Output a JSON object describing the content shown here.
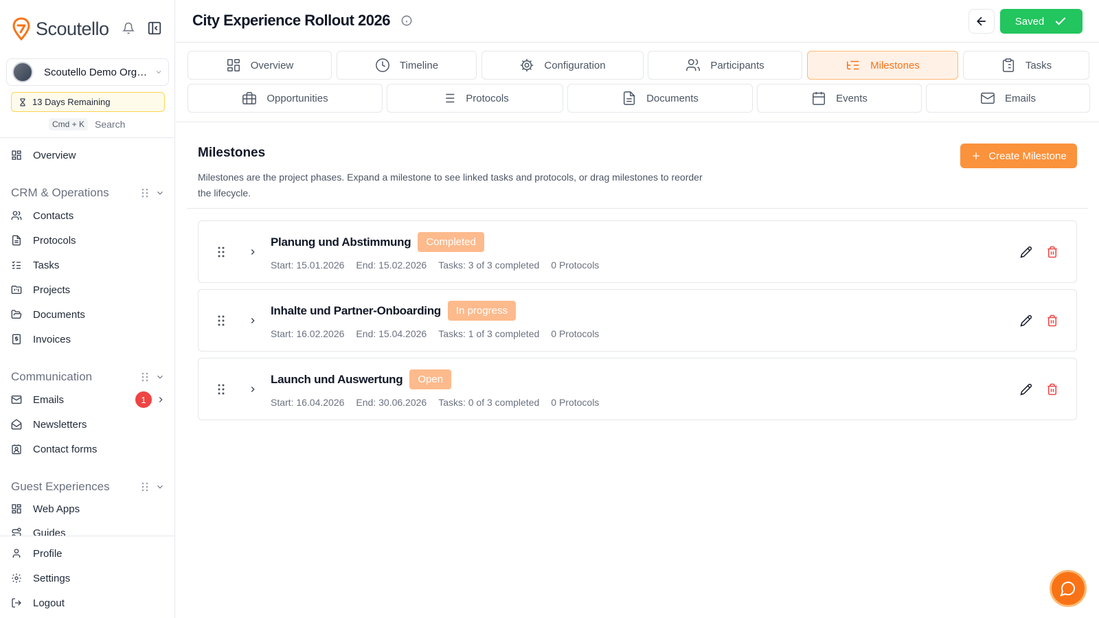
{
  "sidebar": {
    "brand": "Scoutello",
    "org_name": "Scoutello Demo Organization",
    "trial": "13 Days Remaining",
    "search_shortcut": "Cmd + K",
    "search_label": "Search",
    "overview": "Overview",
    "groups": {
      "crm": "CRM & Operations",
      "communication": "Communication",
      "guest": "Guest Experiences"
    },
    "crm_items": [
      "Contacts",
      "Protocols",
      "Tasks",
      "Projects",
      "Documents",
      "Invoices"
    ],
    "comm_items": [
      "Emails",
      "Newsletters",
      "Contact forms"
    ],
    "guest_items": [
      "Web Apps",
      "Guides"
    ],
    "email_badge": "1",
    "footer_items": [
      "Profile",
      "Settings",
      "Logout"
    ]
  },
  "header": {
    "title": "City Experience Rollout 2026",
    "saved_label": "Saved"
  },
  "tabs": [
    {
      "label": "Overview",
      "icon": "grid-icon"
    },
    {
      "label": "Timeline",
      "icon": "clock-icon"
    },
    {
      "label": "Configuration",
      "icon": "gear-icon"
    },
    {
      "label": "Participants",
      "icon": "users-icon"
    },
    {
      "label": "Milestones",
      "icon": "list-tree-icon",
      "active": true
    },
    {
      "label": "Tasks",
      "icon": "clipboard-icon"
    },
    {
      "label": "Opportunities",
      "icon": "briefcase-icon"
    },
    {
      "label": "Protocols",
      "icon": "list-icon"
    },
    {
      "label": "Documents",
      "icon": "file-icon"
    },
    {
      "label": "Events",
      "icon": "calendar-icon"
    },
    {
      "label": "Emails",
      "icon": "mail-icon"
    }
  ],
  "milestones_section": {
    "title": "Milestones",
    "description": "Milestones are the project phases. Expand a milestone to see linked tasks and protocols, or drag milestones to reorder the lifecycle.",
    "create_label": "Create Milestone"
  },
  "milestones": [
    {
      "name": "Planung und Abstimmung",
      "status": "Completed",
      "start": "Start: 15.01.2026",
      "end": "End: 15.02.2026",
      "tasks": "Tasks: 3 of 3 completed",
      "protocols": "0 Protocols"
    },
    {
      "name": "Inhalte und Partner-Onboarding",
      "status": "In progress",
      "start": "Start: 16.02.2026",
      "end": "End: 15.04.2026",
      "tasks": "Tasks: 1 of 3 completed",
      "protocols": "0 Protocols"
    },
    {
      "name": "Launch und Auswertung",
      "status": "Open",
      "start": "Start: 16.04.2026",
      "end": "End: 30.06.2026",
      "tasks": "Tasks: 0 of 3 completed",
      "protocols": "0 Protocols"
    }
  ],
  "colors": {
    "accent": "#f97316",
    "saved": "#22c55e",
    "danger": "#ef4444",
    "status_badge": "#fdba8c"
  }
}
